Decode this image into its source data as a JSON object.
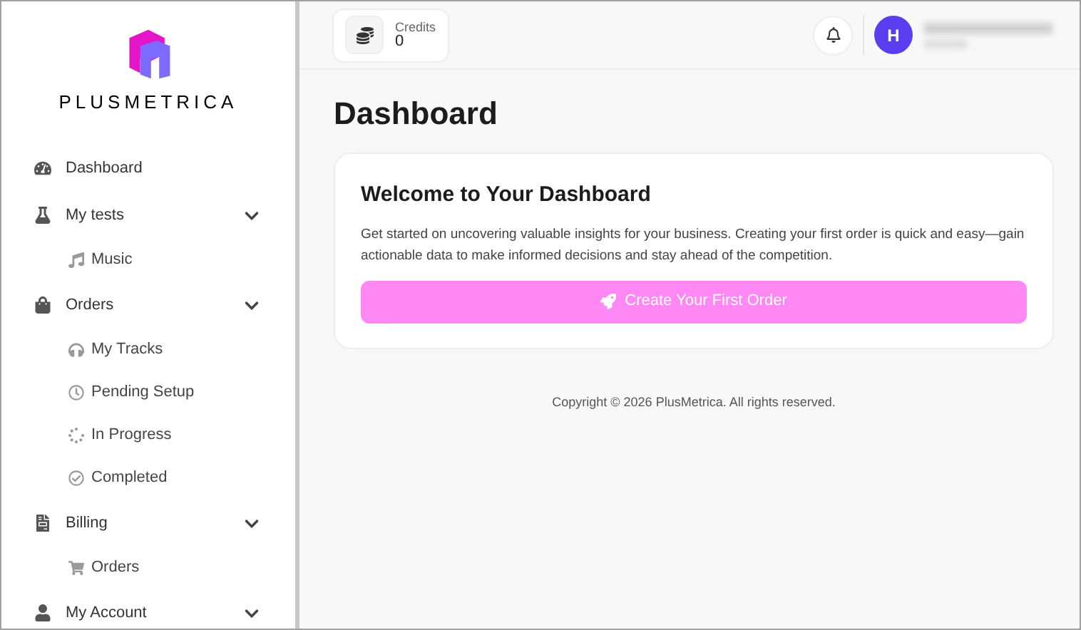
{
  "brand": {
    "name": "PLUSMETRICA"
  },
  "sidebar": {
    "items": [
      {
        "label": "Dashboard",
        "kind": "link"
      },
      {
        "label": "My tests",
        "kind": "group",
        "expanded": true,
        "children": [
          {
            "label": "Music"
          }
        ]
      },
      {
        "label": "Orders",
        "kind": "group",
        "expanded": true,
        "children": [
          {
            "label": "My Tracks"
          },
          {
            "label": "Pending Setup"
          },
          {
            "label": "In Progress"
          },
          {
            "label": "Completed"
          }
        ]
      },
      {
        "label": "Billing",
        "kind": "group",
        "expanded": true,
        "children": [
          {
            "label": "Orders"
          }
        ]
      },
      {
        "label": "My Account",
        "kind": "group",
        "expanded": true
      }
    ]
  },
  "header": {
    "credits": {
      "label": "Credits",
      "value": "0"
    },
    "avatar": {
      "initial": "H"
    }
  },
  "page": {
    "title": "Dashboard"
  },
  "welcome": {
    "title": "Welcome to Your Dashboard",
    "text": "Get started on uncovering valuable insights for your business. Creating your first order is quick and easy—gain actionable data to make informed decisions and stay ahead of the competition.",
    "button": "Create Your First Order"
  },
  "footer": {
    "copyright": "Copyright © 2026 PlusMetrica. All rights reserved."
  }
}
